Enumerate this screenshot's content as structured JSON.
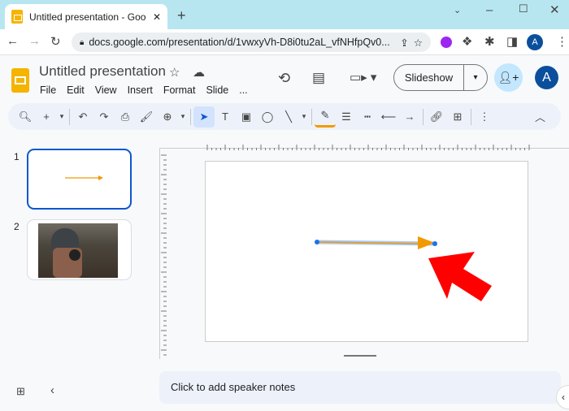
{
  "browser": {
    "tab_title": "Untitled presentation - Google Sl",
    "url": "docs.google.com/presentation/d/1vwxyVh-D8i0tu2aL_vfNHfpQv0...",
    "profile_initial": "A"
  },
  "app": {
    "title": "Untitled presentation",
    "menu": [
      "File",
      "Edit",
      "View",
      "Insert",
      "Format",
      "Slide",
      "..."
    ],
    "slideshow_label": "Slideshow",
    "avatar_initial": "A"
  },
  "toolbar": [
    {
      "name": "search",
      "g": "🔍︎"
    },
    {
      "name": "new-slide",
      "g": "+"
    },
    {
      "name": "new-slide-dropdown",
      "g": "▾",
      "s": 1
    },
    {
      "sep": 1
    },
    {
      "name": "undo",
      "g": "↶"
    },
    {
      "name": "redo",
      "g": "↷"
    },
    {
      "name": "print",
      "g": "⎙"
    },
    {
      "name": "paint-format",
      "g": "🖌︎"
    },
    {
      "name": "zoom",
      "g": "⊕"
    },
    {
      "name": "zoom-dropdown",
      "g": "▾",
      "s": 1
    },
    {
      "sep": 1
    },
    {
      "name": "select",
      "g": "➤",
      "a": 1
    },
    {
      "name": "text-box",
      "g": "T"
    },
    {
      "name": "image",
      "g": "▣"
    },
    {
      "name": "shape",
      "g": "◯"
    },
    {
      "name": "line",
      "g": "╲"
    },
    {
      "name": "line-dropdown",
      "g": "▾",
      "s": 1
    },
    {
      "sep": 1
    },
    {
      "name": "border-color",
      "g": "✎",
      "c": "#f29900"
    },
    {
      "name": "border-weight",
      "g": "☰"
    },
    {
      "name": "border-dash",
      "g": "┅"
    },
    {
      "name": "line-start",
      "g": "⟵"
    },
    {
      "name": "line-end",
      "g": "→"
    },
    {
      "sep": 1
    },
    {
      "name": "insert-link",
      "g": "🔗︎"
    },
    {
      "name": "add-comment",
      "g": "⊞"
    },
    {
      "sep": 1
    },
    {
      "name": "more",
      "g": "⋮"
    }
  ],
  "slides": [
    {
      "number": "1"
    },
    {
      "number": "2"
    }
  ],
  "notes_placeholder": "Click to add speaker notes",
  "colors": {
    "accent": "#0b57d0",
    "arrow_line": "#f29900",
    "annotation": "#ff0000"
  }
}
